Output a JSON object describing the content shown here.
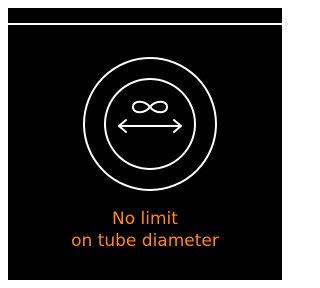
{
  "feature": {
    "icon": "infinity-diameter-icon",
    "caption_line1": "No limit",
    "caption_line2": "on tube diameter"
  },
  "colors": {
    "background": "#000000",
    "icon": "#ffffff",
    "caption": "#ff8a1c"
  }
}
